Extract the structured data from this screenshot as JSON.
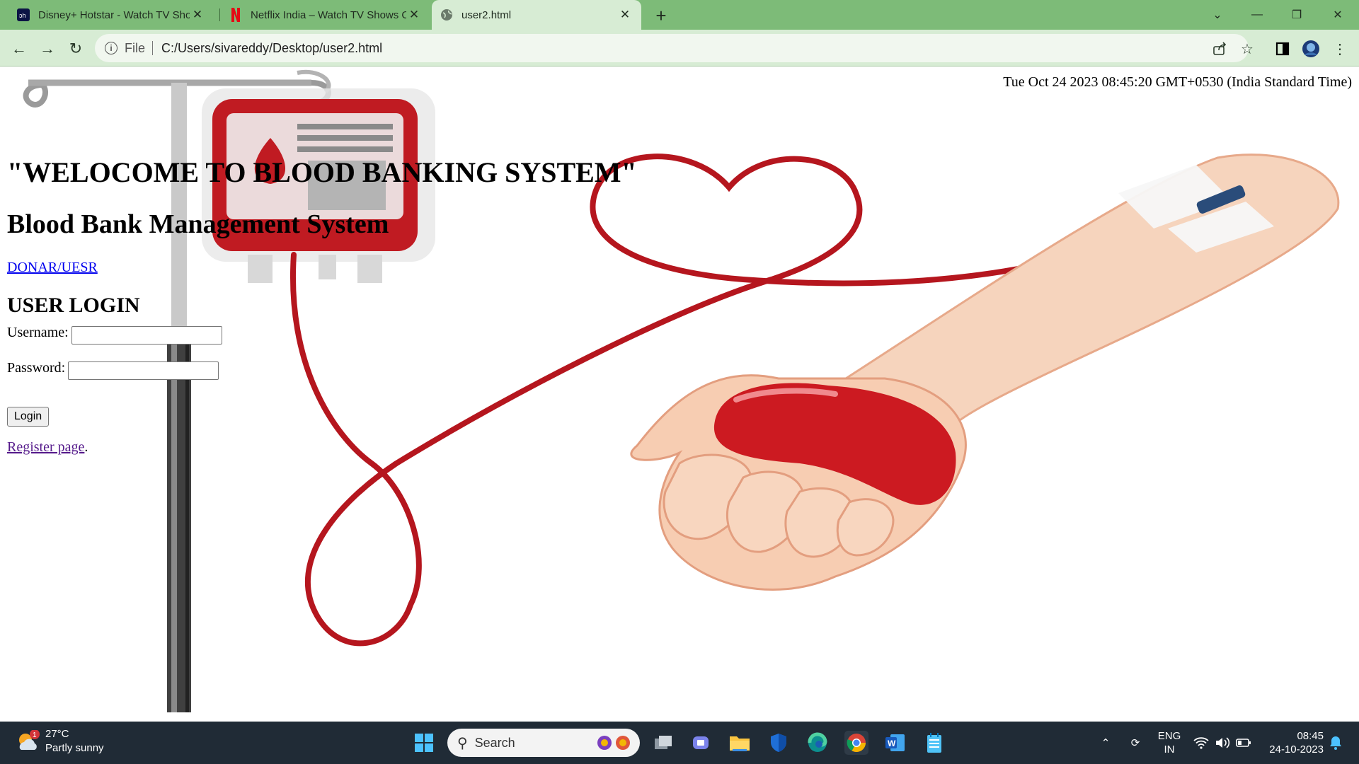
{
  "browser": {
    "tabs": [
      {
        "title": "Disney+ Hotstar - Watch TV Shows",
        "favicon": "hotstar-icon"
      },
      {
        "title": "Netflix India – Watch TV Shows Online",
        "favicon": "netflix-icon"
      },
      {
        "title": "user2.html",
        "favicon": "globe-icon"
      }
    ],
    "address": {
      "scheme": "File",
      "url": "C:/Users/sivareddy/Desktop/user2.html"
    }
  },
  "page": {
    "datetime": "Tue Oct 24 2023 08:45:20 GMT+0530 (India Standard Time)",
    "welcome": "\"WELOCOME TO BLOOD BANKING SYSTEM\"",
    "system_title": "Blood Bank Management System",
    "donar_link": "DONAR/UESR",
    "login_heading": "USER LOGIN",
    "username_label": "Username:",
    "username_value": "",
    "password_label": "Password:",
    "password_value": "",
    "login_button": "Login",
    "register_link": "Register page",
    "register_suffix": "."
  },
  "taskbar": {
    "weather_badge": "1",
    "temperature": "27°C",
    "condition": "Partly sunny",
    "search_label": "Search",
    "language": "ENG",
    "region": "IN",
    "time": "08:45",
    "date": "24-10-2023"
  },
  "colors": {
    "tab_strip": "#7dbb78",
    "toolbar": "#d7ecd4",
    "taskbar": "#202b36",
    "blood_red": "#c8151d"
  }
}
